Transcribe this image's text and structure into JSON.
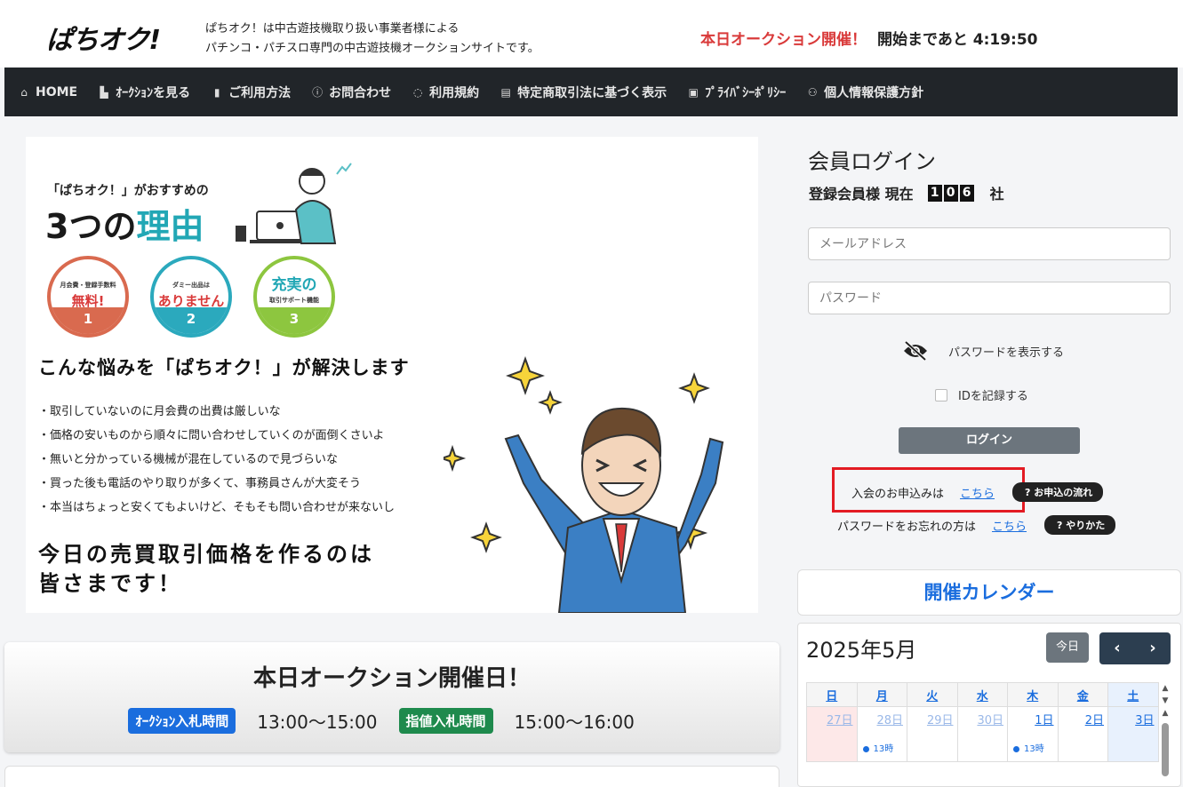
{
  "header": {
    "logo": "ぱちオク!",
    "tagline_line1": "ぱちオク！は中古遊技機取り扱い事業者様による",
    "tagline_line2": "パチンコ・パチスロ専門の中古遊技機オークションサイトです。",
    "announce_red": "本日オークション開催！",
    "announce_countdown": "開始まであと 4:19:50",
    "colors": {
      "accent_red": "#d93a3a",
      "nav_bg": "#212529"
    }
  },
  "nav": {
    "items": [
      {
        "label": "HOME",
        "icon": "home-icon",
        "glyph": "⌂"
      },
      {
        "label": "ｵｰｸｼｮﾝを見る",
        "icon": "cart-icon",
        "glyph": "🛒"
      },
      {
        "label": "ご利用方法",
        "icon": "book-icon",
        "glyph": "▮"
      },
      {
        "label": "お問合わせ",
        "icon": "question-circle-icon",
        "glyph": "?"
      },
      {
        "label": "利用規約",
        "icon": "shield-icon",
        "glyph": "!"
      },
      {
        "label": "特定商取引法に基づく表示",
        "icon": "document-icon",
        "glyph": "▤"
      },
      {
        "label": "ﾌﾟﾗｲﾊﾞｼｰﾎﾟﾘｼｰ",
        "icon": "lock-icon",
        "glyph": "🔒"
      },
      {
        "label": "個人情報保護方針",
        "icon": "user-icon",
        "glyph": "⚇"
      }
    ]
  },
  "banner": {
    "subtitle": "「ぱちオク！」がおすすめの",
    "title_main": "3つの",
    "title_accent": "理由",
    "reasons": [
      {
        "caption": "月会費・登録手数料",
        "headline": "無料!",
        "number": "1"
      },
      {
        "caption": "ダミー出品は",
        "headline": "ありません",
        "number": "2"
      },
      {
        "caption": "取引サポート機能",
        "headline": "充実の",
        "number": "3"
      }
    ],
    "headline": "こんな悩みを「ぱちオク！」が解決します",
    "bullets": [
      "・取引していないのに月会費の出費は厳しいな",
      "・価格の安いものから順々に問い合わせしていくのが面倒くさいよ",
      "・無いと分かっている機械が混在しているので見づらいな",
      "・買った後も電話のやり取りが多くて、事務員さんが大変そう",
      "・本当はちょっと安くてもよいけど、そもそも問い合わせが来ないし"
    ],
    "bottom_line1": "今日の売買取引価格を作るのは",
    "bottom_line2": "皆さまです！"
  },
  "auction": {
    "title": "本日オークション開催日！",
    "bid_label": "ｵｰｸｼｮﾝ入札時間",
    "bid_time": "13:00〜15:00",
    "limit_label": "指値入札時間",
    "limit_time": "15:00〜16:00"
  },
  "login": {
    "title": "会員ログイン",
    "member_prefix": "登録会員様 現在",
    "member_digits": [
      "1",
      "0",
      "6"
    ],
    "member_suffix": "社",
    "email_placeholder": "メールアドレス",
    "password_placeholder": "パスワード",
    "show_password": "パスワードを表示する",
    "remember_id": "IDを記録する",
    "login_button": "ログイン",
    "apply_text": "入会のお申込みは",
    "apply_link": "こちら",
    "apply_help": "? お申込の流れ",
    "forgot_text": "パスワードをお忘れの方は",
    "forgot_link": "こちら",
    "forgot_help": "? やりかた"
  },
  "calendar": {
    "header": "開催カレンダー",
    "month": "2025年5月",
    "today_button": "今日",
    "prev": "‹",
    "next": "›",
    "weekdays": [
      "日",
      "月",
      "火",
      "水",
      "木",
      "金",
      "土"
    ],
    "days": [
      {
        "label": "27日",
        "other": true,
        "event": ""
      },
      {
        "label": "28日",
        "other": true,
        "event": "13時"
      },
      {
        "label": "29日",
        "other": true,
        "event": ""
      },
      {
        "label": "30日",
        "other": true,
        "event": ""
      },
      {
        "label": "1日",
        "other": false,
        "event": "13時"
      },
      {
        "label": "2日",
        "other": false,
        "event": ""
      },
      {
        "label": "3日",
        "other": false,
        "event": ""
      }
    ]
  }
}
